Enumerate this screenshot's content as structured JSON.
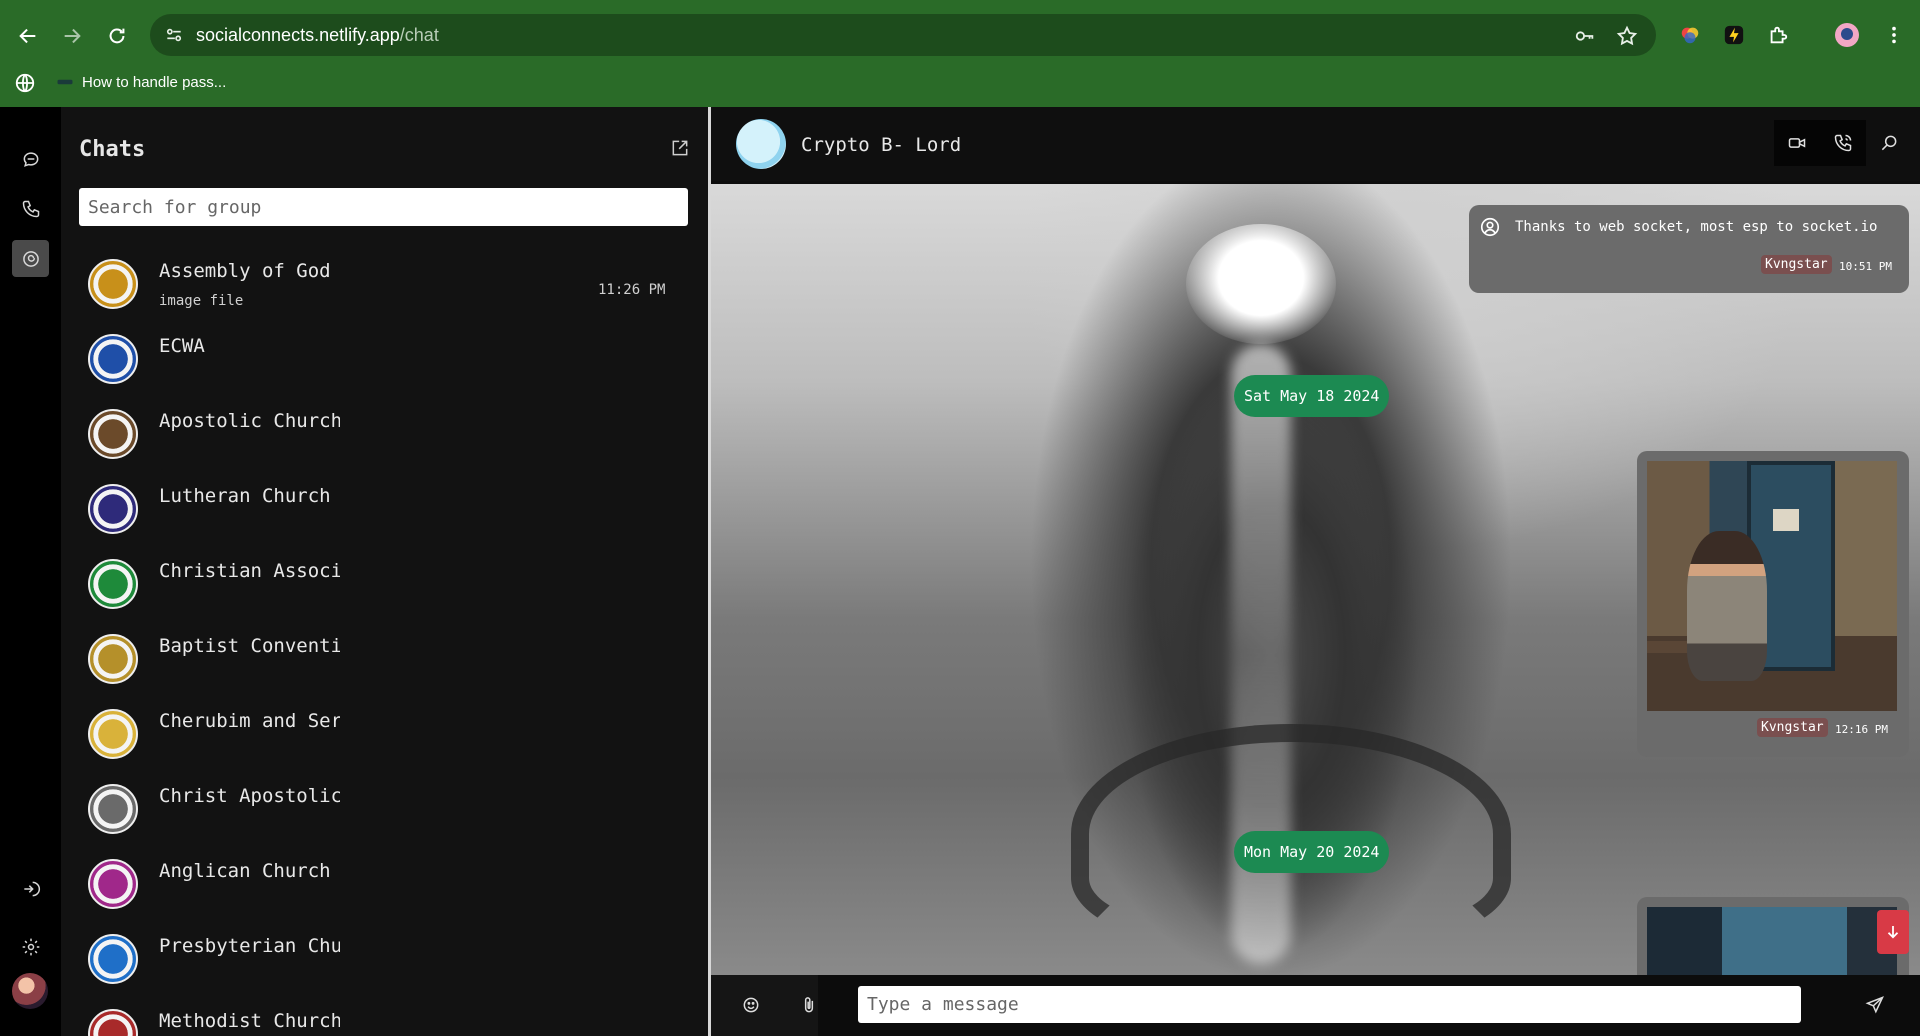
{
  "browser": {
    "url_host": "socialconnects.netlify.app",
    "url_path": "/chat",
    "bookmark_label": "How to handle pass..."
  },
  "sidebar": {
    "title": "Chats",
    "search_placeholder": "Search for group",
    "chats": [
      {
        "name": "Assembly of God",
        "sub": "image file",
        "time": "11:26 PM",
        "color": "#c8901a"
      },
      {
        "name": "ECWA",
        "sub": "",
        "time": "",
        "color": "#1f4fa8"
      },
      {
        "name": "Apostolic Church",
        "sub": "",
        "time": "",
        "color": "#6b4a2a"
      },
      {
        "name": "Lutheran Church",
        "sub": "",
        "time": "",
        "color": "#2e2a7a"
      },
      {
        "name": "Christian Association of Nigeria",
        "sub": "",
        "time": "",
        "color": "#1e8a3a"
      },
      {
        "name": "Baptist Convention",
        "sub": "",
        "time": "",
        "color": "#b5902a"
      },
      {
        "name": "Cherubim and Seraphim",
        "sub": "",
        "time": "",
        "color": "#d9b23a"
      },
      {
        "name": "Christ Apostolic Church",
        "sub": "",
        "time": "",
        "color": "#6a6a6a"
      },
      {
        "name": "Anglican Church",
        "sub": "",
        "time": "",
        "color": "#a0288a"
      },
      {
        "name": "Presbyterian Church",
        "sub": "",
        "time": "",
        "color": "#1f6fc8"
      },
      {
        "name": "Methodist Church",
        "sub": "",
        "time": "",
        "color": "#a82a2a"
      }
    ]
  },
  "conversation": {
    "contact_name": "Crypto B- Lord",
    "messages": [
      {
        "text": "Thanks to web socket, most esp to socket.io",
        "sender": "Kvngstar",
        "time": "10:51 PM"
      },
      {
        "sender": "Kvngstar",
        "time": "12:16 PM",
        "type": "image"
      }
    ],
    "dates": [
      "Sat May 18 2024",
      "Mon May 20 2024"
    ],
    "composer_placeholder": "Type a message"
  },
  "colors": {
    "browser_green": "#2a6b28",
    "date_pill": "#1c8a52",
    "scroll_button": "#d83a46",
    "sender_tag": "#7a4f4f"
  }
}
